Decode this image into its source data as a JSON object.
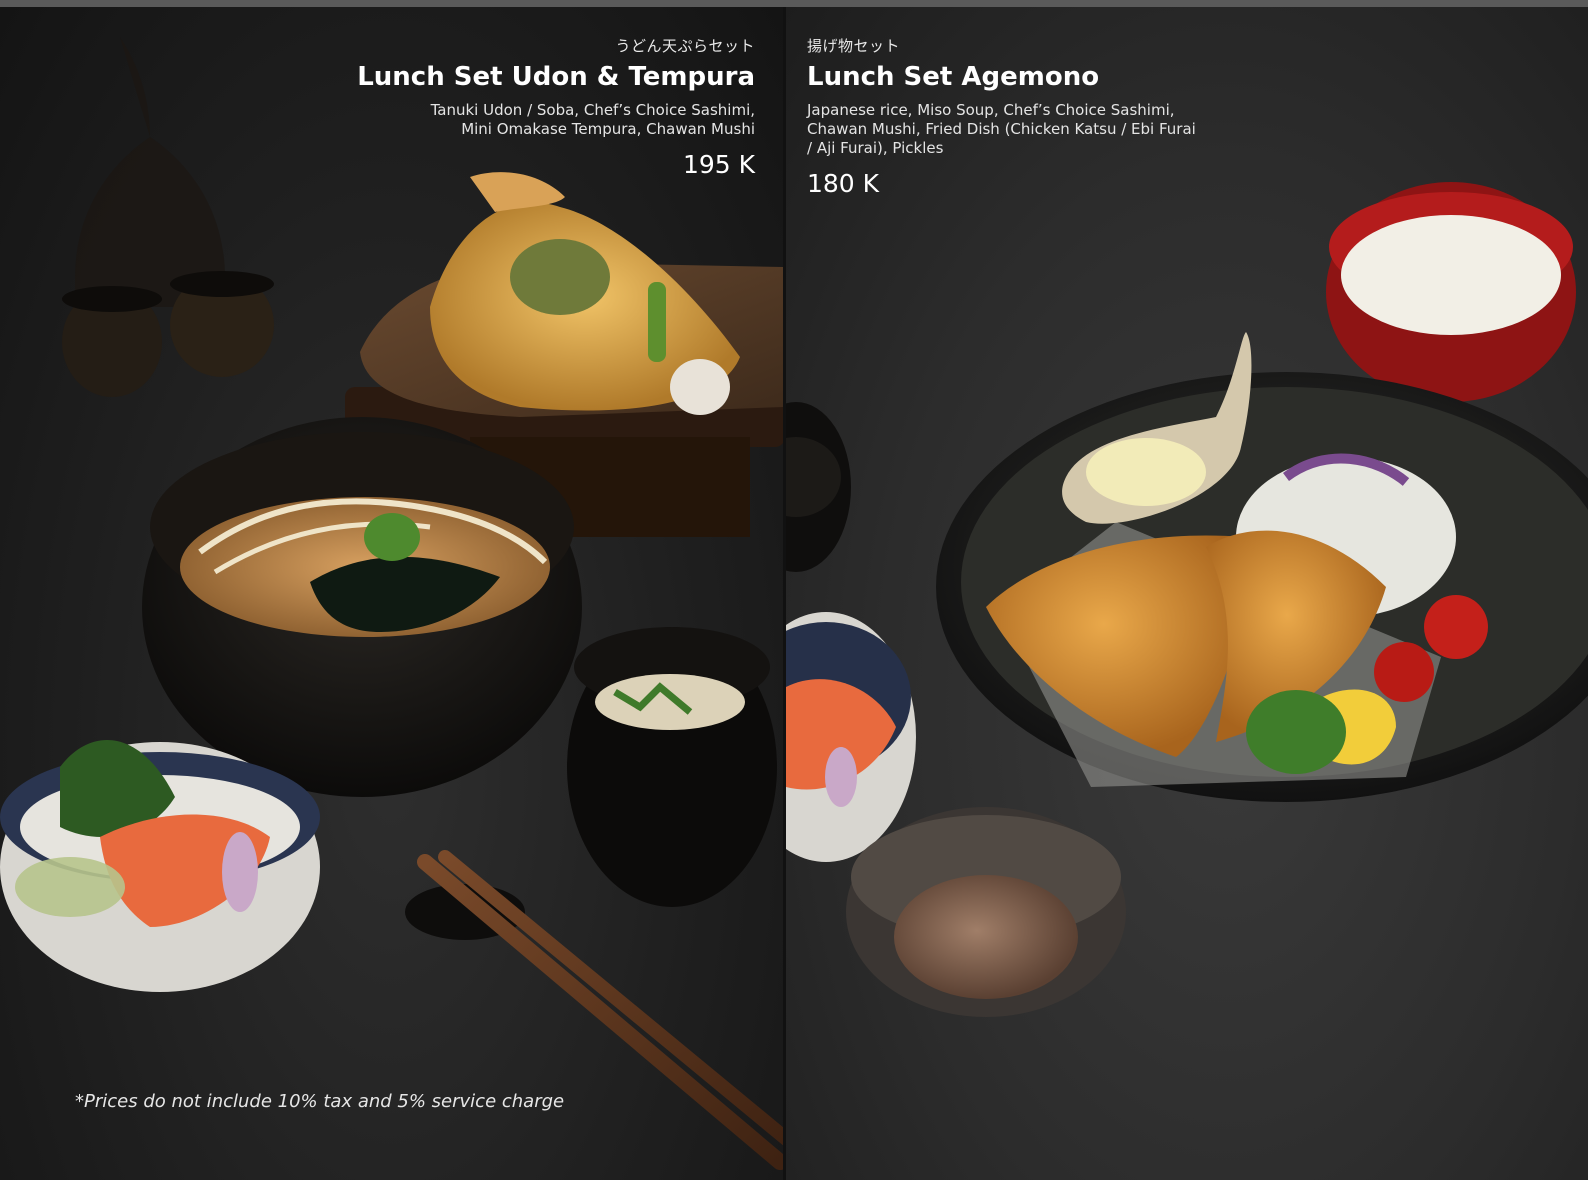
{
  "left_page": {
    "japanese_title": "うどん天ぷらセット",
    "title": "Lunch Set Udon & Tempura",
    "description_lines": [
      "Tanuki Udon / Soba, Chef’s Choice Sashimi,",
      "Mini Omakase Tempura, Chawan Mushi"
    ],
    "price": "195 K",
    "footnote": "*Prices do not include 10% tax and 5% service charge"
  },
  "right_page": {
    "japanese_title": "揚げ物セット",
    "title": "Lunch Set Agemono",
    "description_lines": [
      "Japanese rice, Miso Soup, Chef’s Choice Sashimi,",
      "Chawan Mushi, Fried Dish (Chicken Katsu / Ebi Furai",
      "/ Aji Furai), Pickles"
    ],
    "price": "180 K"
  }
}
